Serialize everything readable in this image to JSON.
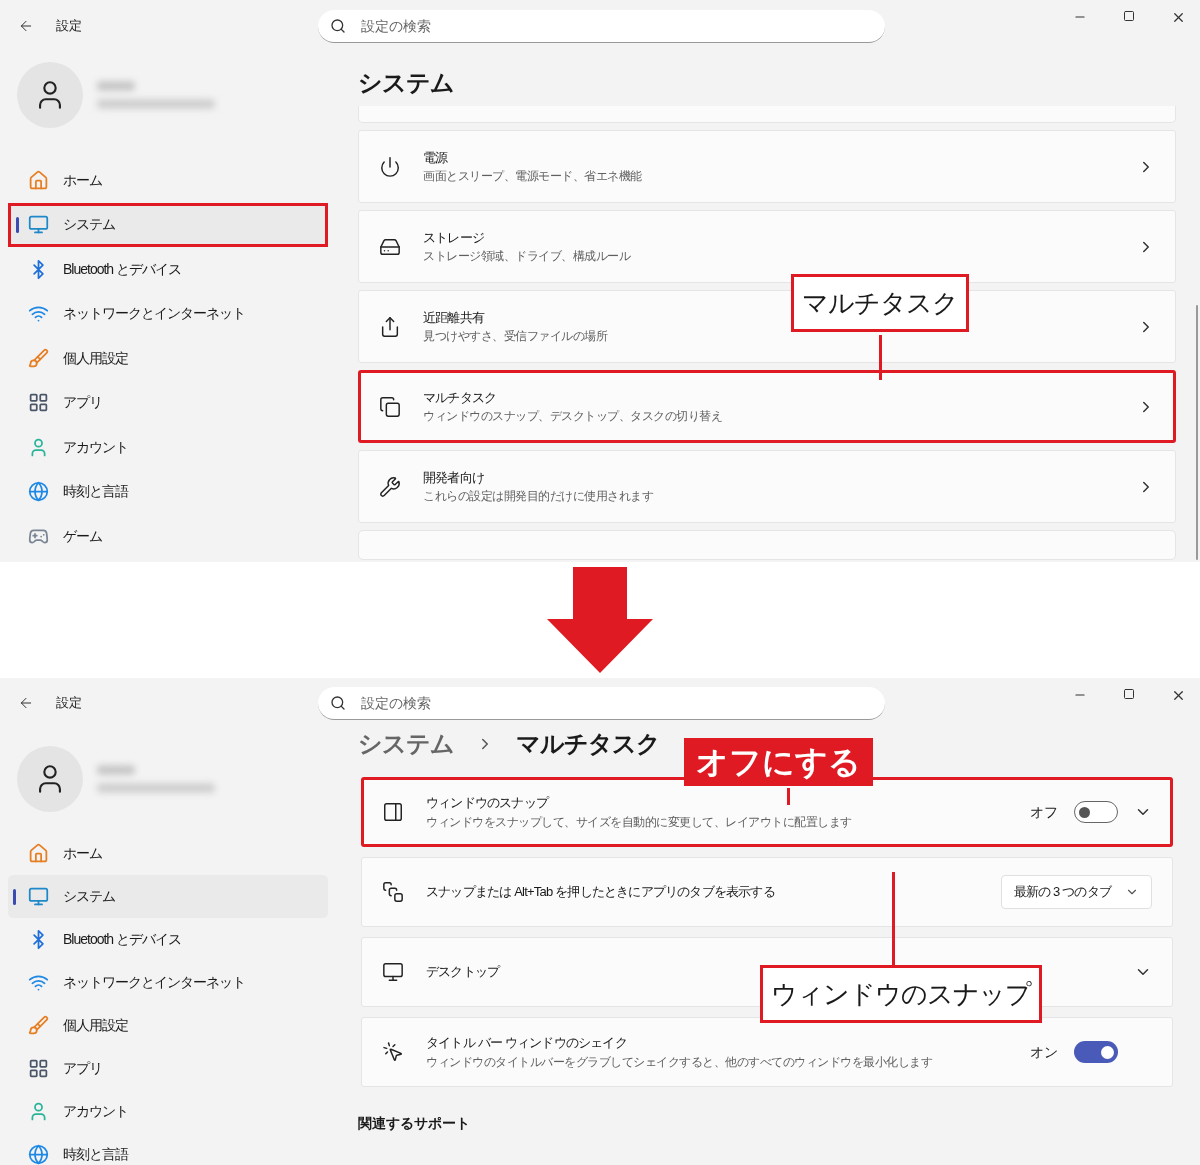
{
  "panels": [
    {
      "kind": "category",
      "app_title": "設定",
      "search": {
        "placeholder": "設定の検索"
      },
      "sidebar": [
        {
          "label": "ホーム",
          "selected": false,
          "highlighted": false
        },
        {
          "label": "システム",
          "selected": true,
          "highlighted": true
        },
        {
          "label": "Bluetooth とデバイス",
          "selected": false,
          "highlighted": false
        },
        {
          "label": "ネットワークとインターネット",
          "selected": false,
          "highlighted": false
        },
        {
          "label": "個人用設定",
          "selected": false,
          "highlighted": false
        },
        {
          "label": "アプリ",
          "selected": false,
          "highlighted": false
        },
        {
          "label": "アカウント",
          "selected": false,
          "highlighted": false
        },
        {
          "label": "時刻と言語",
          "selected": false,
          "highlighted": false
        },
        {
          "label": "ゲーム",
          "selected": false,
          "highlighted": false
        }
      ],
      "breadcrumb": [
        {
          "label": "システム"
        }
      ],
      "cards": [
        {
          "kind": "link",
          "title": "電源",
          "subtitle": "画面とスリープ、電源モード、省エネ機能",
          "highlighted": false
        },
        {
          "kind": "link",
          "title": "ストレージ",
          "subtitle": "ストレージ領域、ドライブ、構成ルール",
          "highlighted": false
        },
        {
          "kind": "link",
          "title": "近距離共有",
          "subtitle": "見つけやすさ、受信ファイルの場所",
          "highlighted": false
        },
        {
          "kind": "link",
          "title": "マルチタスク",
          "subtitle": "ウィンドウのスナップ、デスクトップ、タスクの切り替え",
          "highlighted": true
        },
        {
          "kind": "link",
          "title": "開発者向け",
          "subtitle": "これらの設定は開発目的だけに使用されます",
          "highlighted": false
        }
      ],
      "callouts": [
        {
          "kind": "outlined",
          "text": "マルチタスク"
        }
      ]
    },
    {
      "kind": "page",
      "app_title": "設定",
      "search": {
        "placeholder": "設定の検索"
      },
      "sidebar": [
        {
          "label": "ホーム",
          "selected": false,
          "highlighted": false
        },
        {
          "label": "システム",
          "selected": true,
          "highlighted": false
        },
        {
          "label": "Bluetooth とデバイス",
          "selected": false,
          "highlighted": false
        },
        {
          "label": "ネットワークとインターネット",
          "selected": false,
          "highlighted": false
        },
        {
          "label": "個人用設定",
          "selected": false,
          "highlighted": false
        },
        {
          "label": "アプリ",
          "selected": false,
          "highlighted": false
        },
        {
          "label": "アカウント",
          "selected": false,
          "highlighted": false
        },
        {
          "label": "時刻と言語",
          "selected": false,
          "highlighted": false
        }
      ],
      "breadcrumb": [
        {
          "label": "システム"
        },
        {
          "label": "マルチタスク"
        }
      ],
      "cards": [
        {
          "kind": "toggle",
          "title": "ウィンドウのスナップ",
          "subtitle": "ウィンドウをスナップして、サイズを自動的に変更して、レイアウトに配置します",
          "state_label": "オフ",
          "on": false,
          "expandable": true,
          "highlighted": true
        },
        {
          "kind": "dropdown",
          "title": "スナップまたは Alt+Tab を押したときにアプリのタブを表示する",
          "value": "最新の 3 つのタブ",
          "highlighted": false
        },
        {
          "kind": "expander",
          "title": "デスクトップ",
          "highlighted": false
        },
        {
          "kind": "toggle",
          "title": "タイトル バー ウィンドウのシェイク",
          "subtitle": "ウィンドウのタイトルバーをグラブしてシェイクすると、他のすべてのウィンドウを最小化します",
          "state_label": "オン",
          "on": true,
          "expandable": false,
          "highlighted": false
        }
      ],
      "section_heading": "関連するサポート",
      "callouts": [
        {
          "kind": "filled",
          "text": "オフにする"
        },
        {
          "kind": "outlined",
          "text": "ウィンドウのスナップ"
        }
      ]
    }
  ]
}
